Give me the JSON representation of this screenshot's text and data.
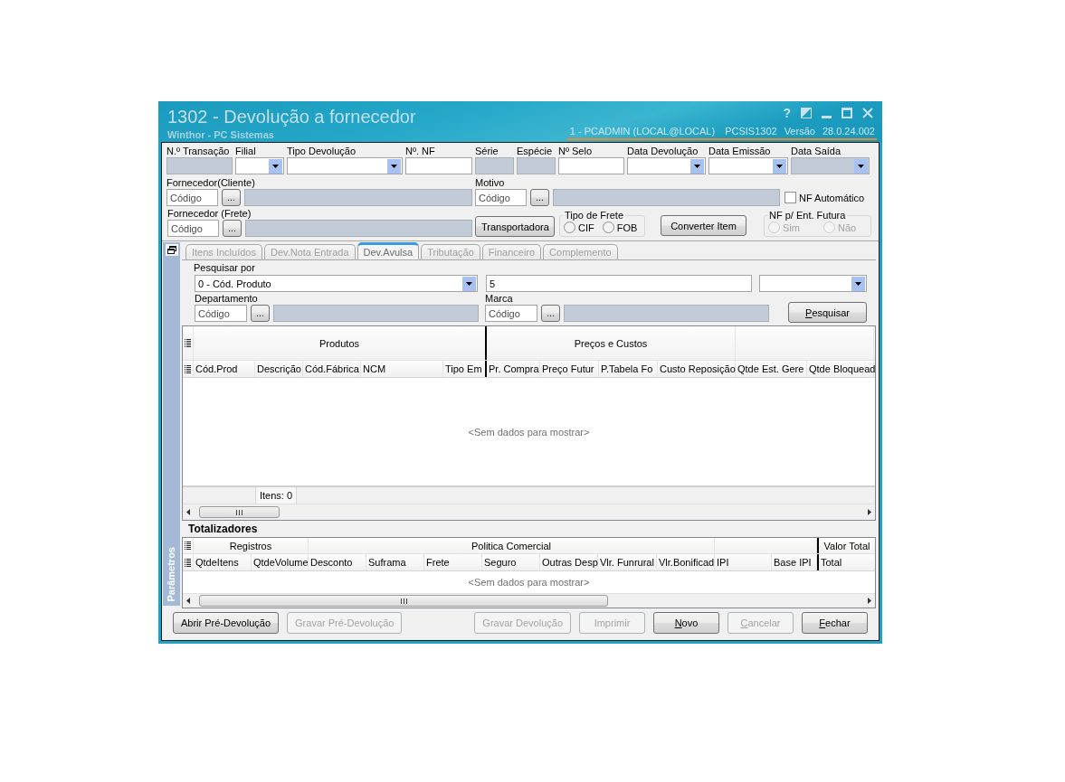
{
  "window": {
    "title": "1302 - Devolução a fornecedor",
    "subtitle": "Winthor - PC Sistemas",
    "help_button": "?",
    "session": [
      "1 - PCADMIN (LOCAL@LOCAL)",
      "PCSIS1302",
      "Versão",
      "28.0.24.002"
    ]
  },
  "header": {
    "row1": [
      {
        "label": "N.º Transação",
        "kind": "text",
        "disabled": true
      },
      {
        "label": "Filial",
        "kind": "dropdown",
        "disabled": false
      },
      {
        "label": "Tipo Devolução",
        "kind": "dropdown",
        "disabled": false
      },
      {
        "label": "Nº. NF",
        "kind": "text",
        "disabled": false
      },
      {
        "label": "Série",
        "kind": "text",
        "disabled": true
      },
      {
        "label": "Espécie",
        "kind": "text",
        "disabled": true
      },
      {
        "label": "Nº Selo",
        "kind": "text",
        "disabled": false
      },
      {
        "label": "Data Devolução",
        "kind": "dropdown",
        "disabled": false
      },
      {
        "label": "Data Emissão",
        "kind": "dropdown",
        "disabled": false
      },
      {
        "label": "Data Saída",
        "kind": "dropdown",
        "disabled": true
      }
    ],
    "fornecedor_cliente": {
      "label": "Fornecedor(Cliente)",
      "placeholder": "Código",
      "button": "..."
    },
    "motivo": {
      "label": "Motivo",
      "placeholder": "Código",
      "button": "..."
    },
    "nf_automatico": {
      "label": "NF Automático",
      "checked": false
    },
    "fornecedor_frete": {
      "label": "Fornecedor (Frete)",
      "placeholder": "Código",
      "button": "..."
    },
    "transportadora_button": "Transportadora",
    "tipo_frete": {
      "title": "Tipo de Frete",
      "disabled": false,
      "options": [
        {
          "label": "CIF",
          "selected": false
        },
        {
          "label": "FOB",
          "selected": false
        }
      ]
    },
    "converter_button": "Converter Item",
    "nf_futura": {
      "title": "NF p/ Ent. Futura",
      "disabled": true,
      "options": [
        {
          "label": "Sim",
          "selected": false
        },
        {
          "label": "Não",
          "selected": false
        }
      ]
    }
  },
  "side_panel": {
    "title": "Parâmetros"
  },
  "tabs": [
    {
      "label": "Itens Incluídos",
      "selected": false
    },
    {
      "label": "Dev.Nota Entrada",
      "selected": false
    },
    {
      "label": "Dev.Avulsa",
      "selected": true
    },
    {
      "label": "Tributação",
      "selected": false
    },
    {
      "label": "Financeiro",
      "selected": false
    },
    {
      "label": "Complemento",
      "selected": false
    }
  ],
  "search": {
    "search_by": {
      "label": "Pesquisar por",
      "value": "0 - Cód. Produto"
    },
    "term": {
      "value": "5"
    },
    "departamento": {
      "label": "Departamento",
      "placeholder": "Código",
      "button": "..."
    },
    "marca": {
      "label": "Marca",
      "placeholder": "Código",
      "button": "..."
    },
    "search_button": {
      "label": "Pesquisar",
      "mnemonic": true
    }
  },
  "products_grid": {
    "bands": [
      {
        "title": "Produtos",
        "fixed_left": true,
        "columns": [
          "Cód.Prod",
          "Descrição",
          "Cód.Fábrica",
          "NCM",
          "Tipo Em"
        ]
      },
      {
        "title": "Preços e Custos",
        "columns": [
          "Pr. Compra",
          "Preço Futur",
          "P.Tabela Fo",
          "Custo Reposição"
        ]
      },
      {
        "columns": [
          "Qtde Est. Gere",
          "Qtde Bloquead"
        ]
      }
    ],
    "empty_text": "<Sem dados para mostrar>",
    "footer": "Itens: 0"
  },
  "totals_grid": {
    "title": "Totalizadores",
    "bands": [
      {
        "title": "Registros",
        "columns": [
          "QtdeItens",
          "QtdeVolume"
        ]
      },
      {
        "title": "Politica Comercial",
        "columns": [
          "Desconto",
          "Suframa",
          "Frete",
          "Seguro",
          "Outras Desp",
          "Vlr. Funrural",
          "Vlr.Bonificad"
        ]
      },
      {
        "columns": [
          "IPI",
          "Base IPI"
        ]
      },
      {
        "title": "Valor Total",
        "fixed_right": true,
        "columns": [
          "Total"
        ]
      }
    ],
    "empty_text": "<Sem dados para mostrar>"
  },
  "buttons": {
    "left": [
      {
        "label": "Abrir Pré-Devolução",
        "disabled": false,
        "mnemonic": false
      },
      {
        "label": "Gravar Pré-Devolução",
        "disabled": true,
        "mnemonic": false
      }
    ],
    "right": [
      {
        "label": "Gravar Devolução",
        "disabled": true,
        "mnemonic": false
      },
      {
        "label": "Imprimir",
        "disabled": true,
        "mnemonic": false
      },
      {
        "label": "Novo",
        "disabled": false,
        "mnemonic": true
      },
      {
        "label": "Cancelar",
        "disabled": true,
        "mnemonic": true
      },
      {
        "label": "Fechar",
        "disabled": false,
        "mnemonic": true
      }
    ]
  }
}
